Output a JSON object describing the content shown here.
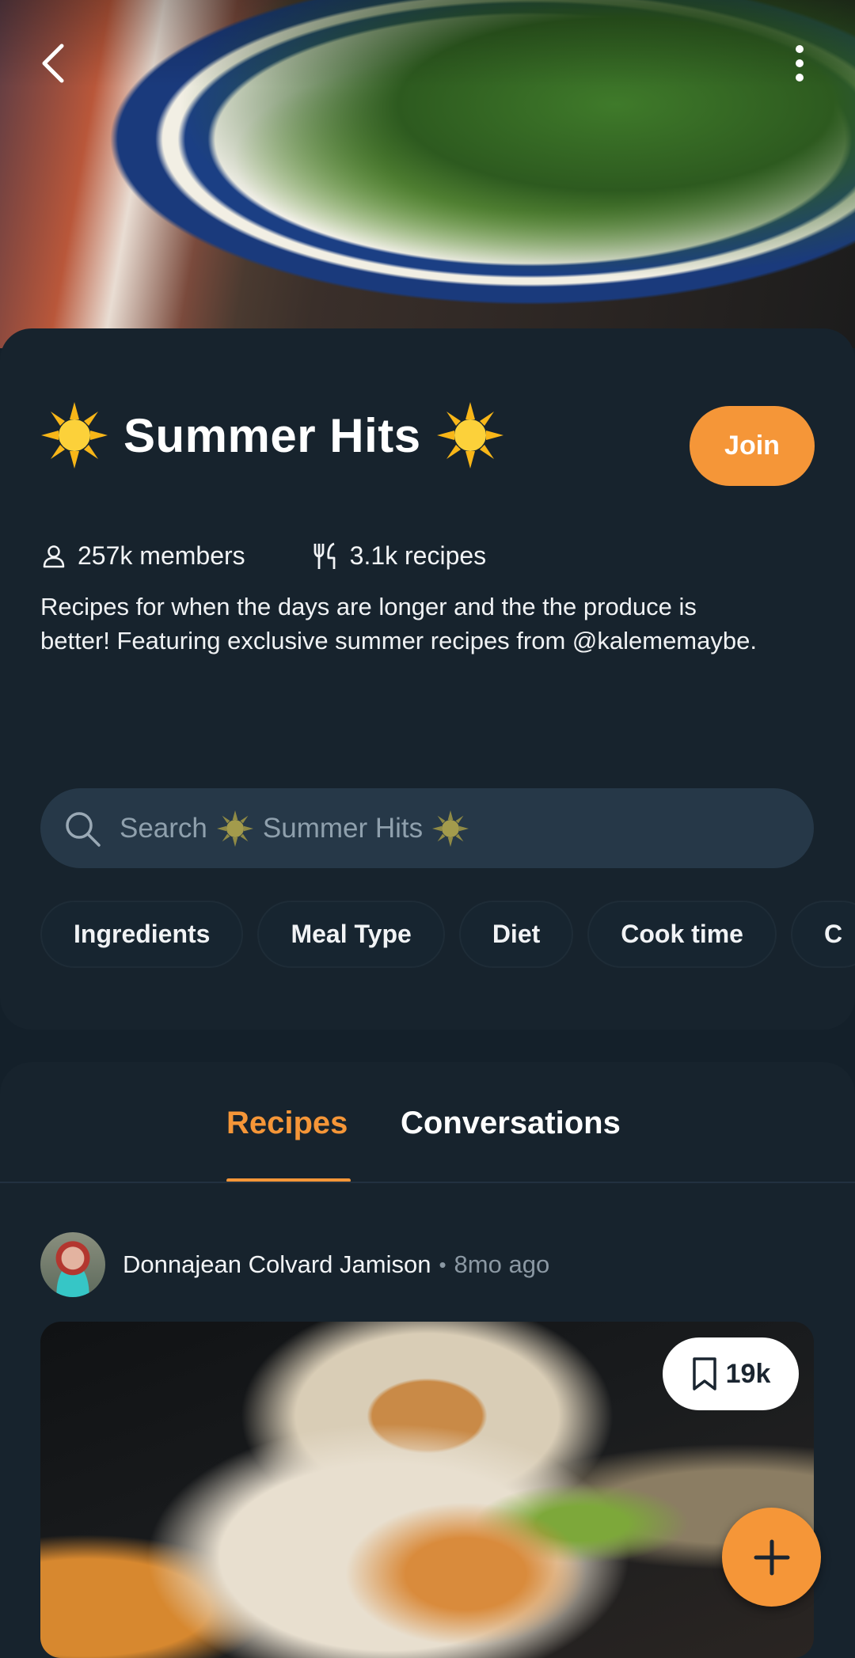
{
  "header": {
    "back_icon": "chevron-left-icon",
    "more_icon": "vertical-dots-icon"
  },
  "community": {
    "title": "Summer Hits",
    "title_emoji": "sun-icon",
    "join_label": "Join",
    "members": "257k members",
    "recipes": "3.1k recipes",
    "description": "Recipes for when the days are longer and the the produce is better! Featuring exclusive summer recipes from @kalememaybe."
  },
  "search": {
    "prefix": "Search",
    "name": "Summer Hits"
  },
  "filters": [
    "Ingredients",
    "Meal Type",
    "Diet",
    "Cook time",
    "C"
  ],
  "tabs": {
    "recipes": "Recipes",
    "conversations": "Conversations",
    "active": "recipes"
  },
  "post": {
    "author": "Donnajean Colvard Jamison",
    "separator": "•",
    "time": "8mo ago",
    "saves": "19k"
  },
  "colors": {
    "accent": "#f59638",
    "background": "#14202a",
    "card": "#17232d",
    "search_bg": "#263848"
  }
}
